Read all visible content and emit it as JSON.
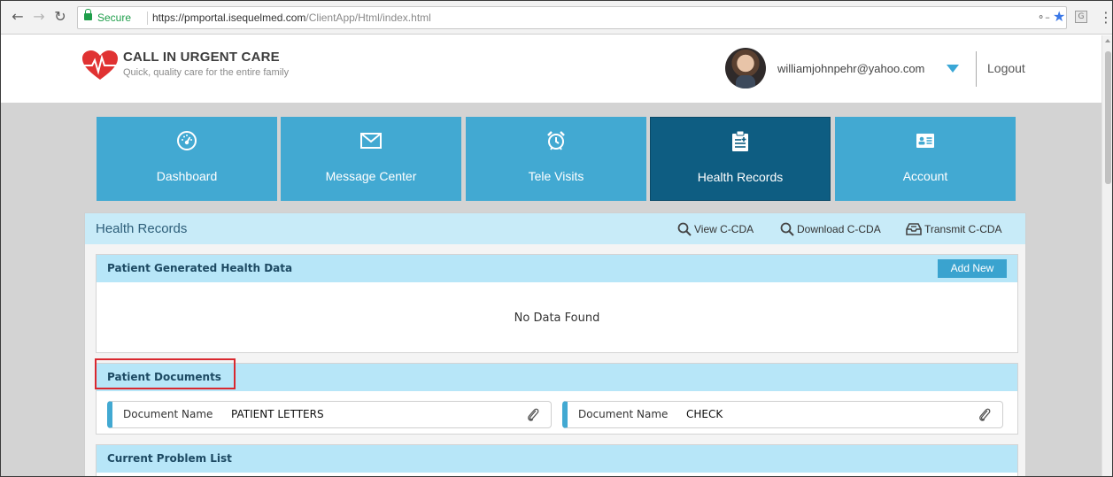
{
  "browser": {
    "back_icon": "back-arrow-icon",
    "forward_icon": "forward-arrow-icon",
    "reload_icon": "reload-icon",
    "secure_label": "Secure",
    "url_host": "https://pmportal.isequelmed.com",
    "url_path": "/ClientApp/Html/index.html"
  },
  "header": {
    "logo_title": "CALL IN URGENT CARE",
    "logo_subtitle": "Quick, quality care for the entire family",
    "user_email": "williamjohnpehr@yahoo.com",
    "logout_label": "Logout"
  },
  "nav_tiles": [
    {
      "label": "Dashboard",
      "icon": "dashboard-gauge-icon",
      "active": false
    },
    {
      "label": "Message Center",
      "icon": "envelope-icon",
      "active": false
    },
    {
      "label": "Tele Visits",
      "icon": "alarm-clock-icon",
      "active": false
    },
    {
      "label": "Health Records",
      "icon": "clipboard-icon",
      "active": true
    },
    {
      "label": "Account",
      "icon": "id-card-icon",
      "active": false
    }
  ],
  "panel": {
    "title": "Health Records",
    "links": {
      "view": "View C-CDA",
      "download": "Download C-CDA",
      "transmit": "Transmit C-CDA"
    }
  },
  "sections": {
    "pghd": {
      "title": "Patient Generated Health Data",
      "add_label": "Add New",
      "empty_text": "No Data Found"
    },
    "documents": {
      "title": "Patient Documents",
      "items": [
        {
          "key": "Document Name",
          "value": "PATIENT LETTERS"
        },
        {
          "key": "Document Name",
          "value": "CHECK"
        }
      ]
    },
    "problems": {
      "title": "Current Problem List"
    }
  },
  "colors": {
    "tile": "#42a9d2",
    "tile_active": "#0e5d82",
    "section_header": "#b7e6f8",
    "highlight": "#d9282f"
  }
}
